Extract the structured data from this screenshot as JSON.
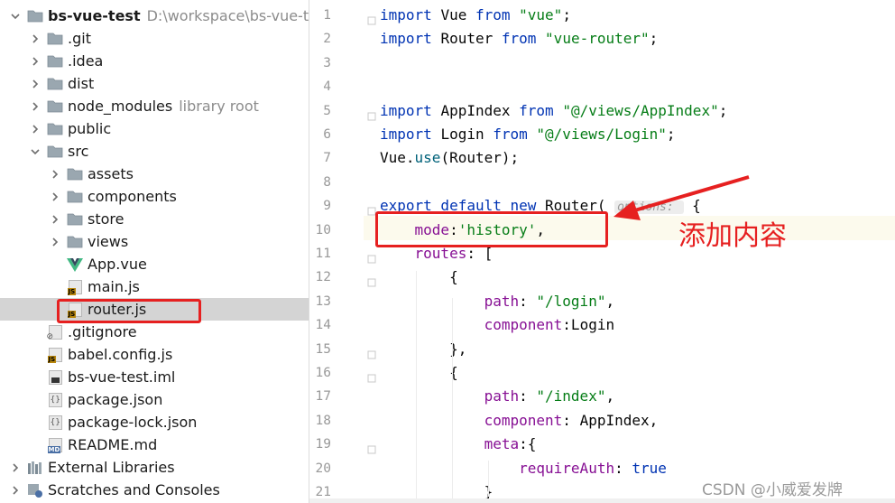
{
  "project_tree": {
    "items": [
      {
        "label": "bs-vue-test",
        "hint": "D:\\workspace\\bs-vue-test",
        "depth": 0,
        "expanded": true,
        "icon": "folder-icon",
        "bold": true
      },
      {
        "label": ".git",
        "depth": 1,
        "expanded": false,
        "icon": "folder-icon"
      },
      {
        "label": ".idea",
        "depth": 1,
        "expanded": false,
        "icon": "folder-icon"
      },
      {
        "label": "dist",
        "depth": 1,
        "expanded": false,
        "icon": "folder-icon"
      },
      {
        "label": "node_modules",
        "hint": "library root",
        "depth": 1,
        "expanded": false,
        "icon": "folder-icon"
      },
      {
        "label": "public",
        "depth": 1,
        "expanded": false,
        "icon": "folder-icon"
      },
      {
        "label": "src",
        "depth": 1,
        "expanded": true,
        "icon": "folder-icon"
      },
      {
        "label": "assets",
        "depth": 2,
        "expanded": false,
        "icon": "folder-icon"
      },
      {
        "label": "components",
        "depth": 2,
        "expanded": false,
        "icon": "folder-icon"
      },
      {
        "label": "store",
        "depth": 2,
        "expanded": false,
        "icon": "folder-icon"
      },
      {
        "label": "views",
        "depth": 2,
        "expanded": false,
        "icon": "folder-icon"
      },
      {
        "label": "App.vue",
        "depth": 2,
        "icon": "vue-file-icon"
      },
      {
        "label": "main.js",
        "depth": 2,
        "icon": "js-file-icon"
      },
      {
        "label": "router.js",
        "depth": 2,
        "icon": "js-file-icon",
        "selected": true
      },
      {
        "label": ".gitignore",
        "depth": 1,
        "icon": "gitignore-file-icon"
      },
      {
        "label": "babel.config.js",
        "depth": 1,
        "icon": "js-file-icon"
      },
      {
        "label": "bs-vue-test.iml",
        "depth": 1,
        "icon": "iml-file-icon"
      },
      {
        "label": "package.json",
        "depth": 1,
        "icon": "json-file-icon"
      },
      {
        "label": "package-lock.json",
        "depth": 1,
        "icon": "json-file-icon"
      },
      {
        "label": "README.md",
        "depth": 1,
        "icon": "md-file-icon"
      },
      {
        "label": "External Libraries",
        "depth": 0,
        "expanded": false,
        "icon": "libraries-icon"
      },
      {
        "label": "Scratches and Consoles",
        "depth": 0,
        "expanded": false,
        "icon": "scratches-icon"
      }
    ]
  },
  "editor": {
    "current_line": 10,
    "lines": [
      {
        "n": "1",
        "t": [
          [
            "kw",
            "import"
          ],
          [
            "",
            "Vue "
          ],
          [
            "kw",
            "from "
          ],
          [
            "str",
            "\"vue\""
          ],
          [
            "",
            ";"
          ]
        ]
      },
      {
        "n": "2",
        "t": [
          [
            "kw",
            "import"
          ],
          [
            "",
            "Router "
          ],
          [
            "kw",
            "from "
          ],
          [
            "str",
            "\"vue-router\""
          ],
          [
            "",
            ";"
          ]
        ]
      },
      {
        "n": "3",
        "t": []
      },
      {
        "n": "4",
        "t": []
      },
      {
        "n": "5",
        "t": [
          [
            "kw",
            "import"
          ],
          [
            "",
            "AppIndex "
          ],
          [
            "kw",
            "from "
          ],
          [
            "str",
            "\"@/views/AppIndex\""
          ],
          [
            "",
            ";"
          ]
        ]
      },
      {
        "n": "6",
        "t": [
          [
            "kw",
            "import"
          ],
          [
            "",
            "Login "
          ],
          [
            "kw",
            "from "
          ],
          [
            "str",
            "\"@/views/Login\""
          ],
          [
            "",
            ";"
          ]
        ]
      },
      {
        "n": "7",
        "t": [
          [
            "",
            "Vue."
          ],
          [
            "fn",
            "use"
          ],
          [
            "",
            "(Router);"
          ]
        ]
      },
      {
        "n": "8",
        "t": []
      },
      {
        "n": "9",
        "t": [
          [
            "kw",
            "export default new "
          ],
          [
            "",
            "Router( "
          ],
          [
            "hint",
            "options: "
          ],
          [
            "",
            " {"
          ]
        ]
      },
      {
        "n": "10",
        "t": [
          [
            "",
            "    "
          ],
          [
            "prop",
            "mode"
          ],
          [
            "",
            ":"
          ],
          [
            "str",
            "'history'"
          ],
          [
            "",
            ","
          ]
        ]
      },
      {
        "n": "11",
        "t": [
          [
            "",
            "    "
          ],
          [
            "prop",
            "routes"
          ],
          [
            "",
            ": ["
          ]
        ]
      },
      {
        "n": "12",
        "t": [
          [
            "",
            "        {"
          ]
        ]
      },
      {
        "n": "13",
        "t": [
          [
            "",
            "            "
          ],
          [
            "prop",
            "path"
          ],
          [
            "",
            ": "
          ],
          [
            "str",
            "\"/login\""
          ],
          [
            "",
            ","
          ]
        ]
      },
      {
        "n": "14",
        "t": [
          [
            "",
            "            "
          ],
          [
            "prop",
            "component"
          ],
          [
            "",
            ":Login"
          ]
        ]
      },
      {
        "n": "15",
        "t": [
          [
            "",
            "        },"
          ]
        ]
      },
      {
        "n": "16",
        "t": [
          [
            "",
            "        {"
          ]
        ]
      },
      {
        "n": "17",
        "t": [
          [
            "",
            "            "
          ],
          [
            "prop",
            "path"
          ],
          [
            "",
            ": "
          ],
          [
            "str",
            "\"/index\""
          ],
          [
            "",
            ","
          ]
        ]
      },
      {
        "n": "18",
        "t": [
          [
            "",
            "            "
          ],
          [
            "prop",
            "component"
          ],
          [
            "",
            ": AppIndex,"
          ]
        ]
      },
      {
        "n": "19",
        "t": [
          [
            "",
            "            "
          ],
          [
            "prop",
            "meta"
          ],
          [
            "",
            ":{"
          ]
        ]
      },
      {
        "n": "20",
        "t": [
          [
            "",
            "                "
          ],
          [
            "prop",
            "requireAuth"
          ],
          [
            "",
            ": "
          ],
          [
            "kw",
            "true"
          ]
        ]
      },
      {
        "n": "21",
        "t": [
          [
            "",
            "            }"
          ]
        ]
      }
    ]
  },
  "annotation": {
    "text": "添加内容",
    "color": "#e62020"
  },
  "watermark": "CSDN @小威爱发牌",
  "colors": {
    "keyword": "#0033b3",
    "string": "#067d17",
    "property": "#871094",
    "selection": "#d4d4d4",
    "current_line": "#fcfaed"
  }
}
